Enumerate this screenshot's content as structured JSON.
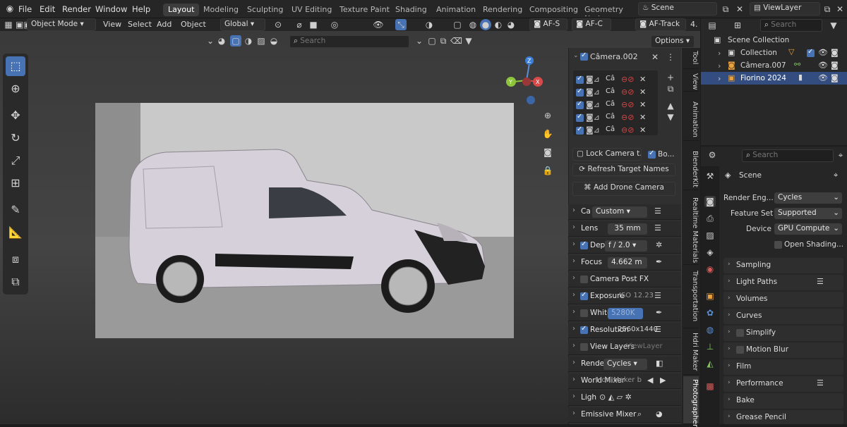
{
  "menubar": {
    "items": [
      "File",
      "Edit",
      "Render",
      "Window",
      "Help"
    ]
  },
  "workspaces": [
    "Layout",
    "Modeling",
    "Sculpting",
    "UV Editing",
    "Texture Paint",
    "Shading",
    "Animation",
    "Rendering",
    "Compositing",
    "Geometry Nod"
  ],
  "scene_field": "Scene",
  "viewlayer_field": "ViewLayer",
  "header": {
    "mode": "Object Mode",
    "menus": [
      "View",
      "Select",
      "Add",
      "Object"
    ],
    "orientation": "Global",
    "af_buttons": [
      "AF-S",
      "AF-C",
      "AF-Track"
    ],
    "af_value": "4.",
    "options": "Options",
    "search_placeholder": "Search"
  },
  "npanel": {
    "camera_name": "Câmera.002",
    "list_rows": [
      "Câ",
      "Câ",
      "Câ",
      "Câ",
      "Câ"
    ],
    "lock_camera": "Lock Camera t...",
    "bo": "Bo...",
    "refresh": "Refresh Target Names",
    "add_drone": "Add Drone Camera",
    "rows": [
      {
        "label": "Ca",
        "value": "Custom"
      },
      {
        "label": "Lens",
        "value": "35 mm"
      },
      {
        "label": "Dep",
        "value": "f / 2.0"
      },
      {
        "label": "Focus",
        "value": "4.662 m"
      },
      {
        "label": "Camera Post FX",
        "value": ""
      },
      {
        "label": "Exposure",
        "value": "ISO 12.23"
      },
      {
        "label": "White",
        "value": "5280K"
      },
      {
        "label": "Resolution",
        "value": "2560x1440"
      },
      {
        "label": "View Layers",
        "value": "ViewLayer"
      },
      {
        "label": "Rende",
        "value": "Cycles"
      },
      {
        "label": "World Mixer",
        "value": "Hdri Maker b..."
      },
      {
        "label": "Ligh",
        "value": ""
      },
      {
        "label": "Emissive Mixer",
        "value": ""
      }
    ]
  },
  "vtabs": [
    "Tool",
    "View",
    "Animation",
    "BlenderKit",
    "Realtime Materials",
    "Transportation",
    "Hdri Maker",
    "Photographer"
  ],
  "outliner": {
    "search_placeholder": "Search",
    "items": [
      "Scene Collection",
      "Collection",
      "Câmera.007",
      "Fiorino 2024"
    ]
  },
  "properties": {
    "search_placeholder": "Search",
    "scene": "Scene",
    "render_engine_label": "Render Eng...",
    "render_engine": "Cycles",
    "feature_set_label": "Feature Set",
    "feature_set": "Supported",
    "device_label": "Device",
    "device": "GPU Compute",
    "open_shading": "Open Shading...",
    "sections": [
      "Sampling",
      "Light Paths",
      "Volumes",
      "Curves",
      "Simplify",
      "Motion Blur",
      "Film",
      "Performance",
      "Bake",
      "Grease Pencil"
    ]
  }
}
